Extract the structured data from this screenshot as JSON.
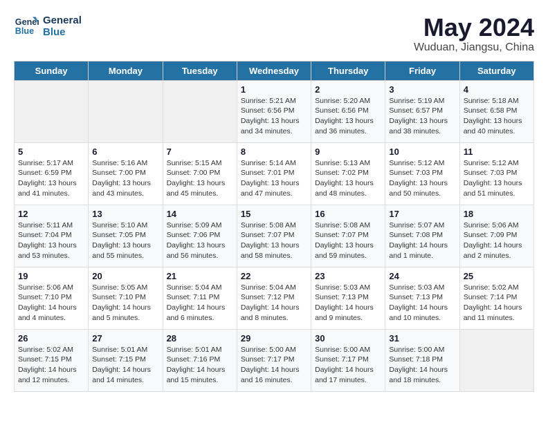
{
  "logo": {
    "line1": "General",
    "line2": "Blue"
  },
  "title": "May 2024",
  "subtitle": "Wuduan, Jiangsu, China",
  "days_of_week": [
    "Sunday",
    "Monday",
    "Tuesday",
    "Wednesday",
    "Thursday",
    "Friday",
    "Saturday"
  ],
  "weeks": [
    [
      {
        "day": "",
        "info": ""
      },
      {
        "day": "",
        "info": ""
      },
      {
        "day": "",
        "info": ""
      },
      {
        "day": "1",
        "info": "Sunrise: 5:21 AM\nSunset: 6:56 PM\nDaylight: 13 hours\nand 34 minutes."
      },
      {
        "day": "2",
        "info": "Sunrise: 5:20 AM\nSunset: 6:56 PM\nDaylight: 13 hours\nand 36 minutes."
      },
      {
        "day": "3",
        "info": "Sunrise: 5:19 AM\nSunset: 6:57 PM\nDaylight: 13 hours\nand 38 minutes."
      },
      {
        "day": "4",
        "info": "Sunrise: 5:18 AM\nSunset: 6:58 PM\nDaylight: 13 hours\nand 40 minutes."
      }
    ],
    [
      {
        "day": "5",
        "info": "Sunrise: 5:17 AM\nSunset: 6:59 PM\nDaylight: 13 hours\nand 41 minutes."
      },
      {
        "day": "6",
        "info": "Sunrise: 5:16 AM\nSunset: 7:00 PM\nDaylight: 13 hours\nand 43 minutes."
      },
      {
        "day": "7",
        "info": "Sunrise: 5:15 AM\nSunset: 7:00 PM\nDaylight: 13 hours\nand 45 minutes."
      },
      {
        "day": "8",
        "info": "Sunrise: 5:14 AM\nSunset: 7:01 PM\nDaylight: 13 hours\nand 47 minutes."
      },
      {
        "day": "9",
        "info": "Sunrise: 5:13 AM\nSunset: 7:02 PM\nDaylight: 13 hours\nand 48 minutes."
      },
      {
        "day": "10",
        "info": "Sunrise: 5:12 AM\nSunset: 7:03 PM\nDaylight: 13 hours\nand 50 minutes."
      },
      {
        "day": "11",
        "info": "Sunrise: 5:12 AM\nSunset: 7:03 PM\nDaylight: 13 hours\nand 51 minutes."
      }
    ],
    [
      {
        "day": "12",
        "info": "Sunrise: 5:11 AM\nSunset: 7:04 PM\nDaylight: 13 hours\nand 53 minutes."
      },
      {
        "day": "13",
        "info": "Sunrise: 5:10 AM\nSunset: 7:05 PM\nDaylight: 13 hours\nand 55 minutes."
      },
      {
        "day": "14",
        "info": "Sunrise: 5:09 AM\nSunset: 7:06 PM\nDaylight: 13 hours\nand 56 minutes."
      },
      {
        "day": "15",
        "info": "Sunrise: 5:08 AM\nSunset: 7:07 PM\nDaylight: 13 hours\nand 58 minutes."
      },
      {
        "day": "16",
        "info": "Sunrise: 5:08 AM\nSunset: 7:07 PM\nDaylight: 13 hours\nand 59 minutes."
      },
      {
        "day": "17",
        "info": "Sunrise: 5:07 AM\nSunset: 7:08 PM\nDaylight: 14 hours\nand 1 minute."
      },
      {
        "day": "18",
        "info": "Sunrise: 5:06 AM\nSunset: 7:09 PM\nDaylight: 14 hours\nand 2 minutes."
      }
    ],
    [
      {
        "day": "19",
        "info": "Sunrise: 5:06 AM\nSunset: 7:10 PM\nDaylight: 14 hours\nand 4 minutes."
      },
      {
        "day": "20",
        "info": "Sunrise: 5:05 AM\nSunset: 7:10 PM\nDaylight: 14 hours\nand 5 minutes."
      },
      {
        "day": "21",
        "info": "Sunrise: 5:04 AM\nSunset: 7:11 PM\nDaylight: 14 hours\nand 6 minutes."
      },
      {
        "day": "22",
        "info": "Sunrise: 5:04 AM\nSunset: 7:12 PM\nDaylight: 14 hours\nand 8 minutes."
      },
      {
        "day": "23",
        "info": "Sunrise: 5:03 AM\nSunset: 7:13 PM\nDaylight: 14 hours\nand 9 minutes."
      },
      {
        "day": "24",
        "info": "Sunrise: 5:03 AM\nSunset: 7:13 PM\nDaylight: 14 hours\nand 10 minutes."
      },
      {
        "day": "25",
        "info": "Sunrise: 5:02 AM\nSunset: 7:14 PM\nDaylight: 14 hours\nand 11 minutes."
      }
    ],
    [
      {
        "day": "26",
        "info": "Sunrise: 5:02 AM\nSunset: 7:15 PM\nDaylight: 14 hours\nand 12 minutes."
      },
      {
        "day": "27",
        "info": "Sunrise: 5:01 AM\nSunset: 7:15 PM\nDaylight: 14 hours\nand 14 minutes."
      },
      {
        "day": "28",
        "info": "Sunrise: 5:01 AM\nSunset: 7:16 PM\nDaylight: 14 hours\nand 15 minutes."
      },
      {
        "day": "29",
        "info": "Sunrise: 5:00 AM\nSunset: 7:17 PM\nDaylight: 14 hours\nand 16 minutes."
      },
      {
        "day": "30",
        "info": "Sunrise: 5:00 AM\nSunset: 7:17 PM\nDaylight: 14 hours\nand 17 minutes."
      },
      {
        "day": "31",
        "info": "Sunrise: 5:00 AM\nSunset: 7:18 PM\nDaylight: 14 hours\nand 18 minutes."
      },
      {
        "day": "",
        "info": ""
      }
    ]
  ]
}
